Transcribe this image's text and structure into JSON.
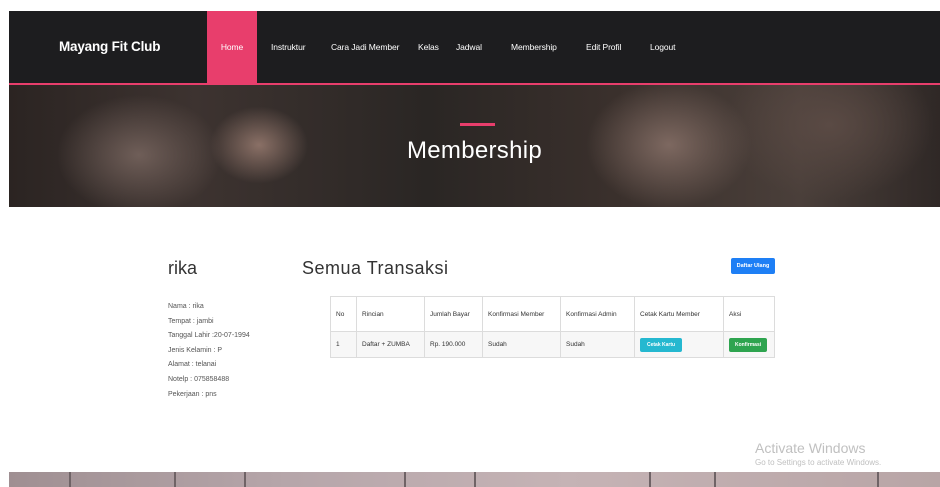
{
  "brand": "Mayang Fit Club",
  "nav": {
    "items": [
      {
        "label": "Home",
        "active": true
      },
      {
        "label": "Instruktur"
      },
      {
        "label": "Cara Jadi Member"
      },
      {
        "label": "Kelas"
      },
      {
        "label": "Jadwal"
      },
      {
        "label": "Membership"
      },
      {
        "label": "Edit Profil"
      },
      {
        "label": "Logout"
      }
    ]
  },
  "hero": {
    "title": "Membership"
  },
  "profile": {
    "name": "rika",
    "details": [
      "Nama : rika",
      "Tempat : jambi",
      "Tanggal Lahir :20-07-1994",
      "Jenis Kelamin : P",
      "Alamat : telanai",
      "Notelp : 075858488",
      "Pekerjaan : pns"
    ]
  },
  "transactions": {
    "title": "Semua Transaksi",
    "daftar_ulang_label": "Daftar Ulang",
    "columns": [
      "No",
      "Rincian",
      "Jumlah Bayar",
      "Konfirmasi Member",
      "Konfirmasi Admin",
      "Cetak Kartu Member",
      "Aksi"
    ],
    "rows": [
      {
        "no": "1",
        "rincian": "Daftar + ZUMBA",
        "jumlah": "Rp. 190.000",
        "konfirmasi_member": "Sudah",
        "konfirmasi_admin": "Sudah",
        "cetak_label": "Cetak Kartu",
        "aksi_label": "Konfirmasi"
      }
    ]
  },
  "watermark": {
    "title": "Activate Windows",
    "subtitle": "Go to Settings to activate Windows."
  },
  "colors": {
    "accent": "#e83e6c",
    "nav_bg": "#1d1d1f",
    "primary_button": "#1e7ff5",
    "info_button": "#25b8d0",
    "success_button": "#2ea44f"
  }
}
